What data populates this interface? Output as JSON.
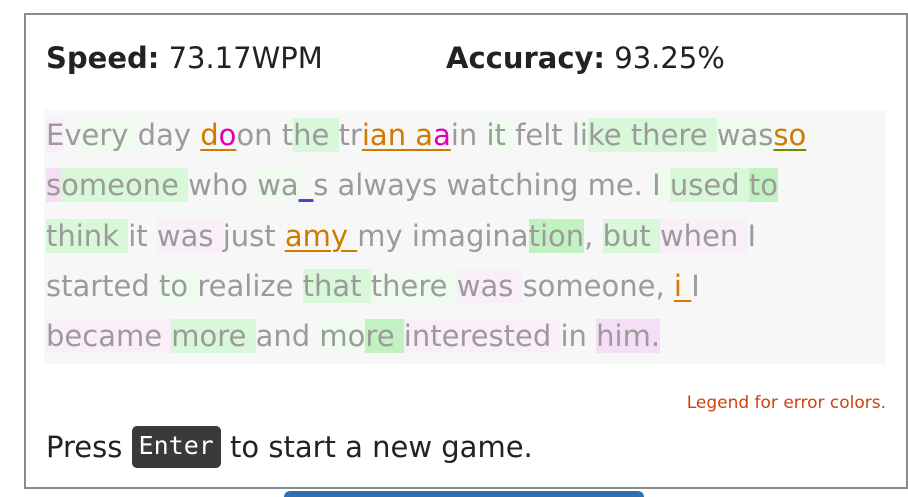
{
  "stats": {
    "speed_label": "Speed:",
    "speed_value": "73.17WPM",
    "accuracy_label": "Accuracy:",
    "accuracy_value": "93.25%"
  },
  "passage": {
    "lines": [
      [
        {
          "t": "E",
          "s": "p1"
        },
        {
          "t": "v",
          "s": ""
        },
        {
          "t": "ery ",
          "s": "g1"
        },
        {
          "t": "day ",
          "s": ""
        },
        {
          "t": "d",
          "s": "err-o"
        },
        {
          "t": "o",
          "s": "err-m"
        },
        {
          "t": "on ",
          "s": ""
        },
        {
          "t": "t",
          "s": "g1"
        },
        {
          "t": "he ",
          "s": "g2"
        },
        {
          "t": "tr",
          "s": ""
        },
        {
          "t": "ian a",
          "s": "err-o"
        },
        {
          "t": "a",
          "s": "err-m"
        },
        {
          "t": "in ",
          "s": ""
        },
        {
          "t": "it ",
          "s": "g1"
        },
        {
          "t": "felt ",
          "s": ""
        },
        {
          "t": "li",
          "s": "g1"
        },
        {
          "t": "ke ",
          "s": "g2"
        },
        {
          "t": "there ",
          "s": "g2"
        },
        {
          "t": "was",
          "s": "g1"
        },
        {
          "t": "so",
          "s": "err-y"
        }
      ],
      [
        {
          "t": "s",
          "s": "p2"
        },
        {
          "t": "omeone ",
          "s": "g2"
        },
        {
          "t": "who ",
          "s": ""
        },
        {
          "t": "wa",
          "s": "g1"
        },
        {
          "t": "_",
          "s": "err-b"
        },
        {
          "t": "s ",
          "s": ""
        },
        {
          "t": "always ",
          "s": ""
        },
        {
          "t": "watching ",
          "s": ""
        },
        {
          "t": "me. ",
          "s": ""
        },
        {
          "t": "I ",
          "s": "g1"
        },
        {
          "t": "used ",
          "s": "g2"
        },
        {
          "t": "to",
          "s": "g3"
        }
      ],
      [
        {
          "t": "think ",
          "s": "g2"
        },
        {
          "t": "it ",
          "s": ""
        },
        {
          "t": "was ",
          "s": "p1"
        },
        {
          "t": "just ",
          "s": ""
        },
        {
          "t": "amy ",
          "s": "err-o"
        },
        {
          "t": "my ",
          "s": ""
        },
        {
          "t": "imagina",
          "s": ""
        },
        {
          "t": "tion",
          "s": "g3"
        },
        {
          "t": ", ",
          "s": ""
        },
        {
          "t": "but ",
          "s": "g2"
        },
        {
          "t": "when ",
          "s": "p1"
        },
        {
          "t": "I",
          "s": ""
        }
      ],
      [
        {
          "t": "started ",
          "s": ""
        },
        {
          "t": "to ",
          "s": "g1"
        },
        {
          "t": "realize ",
          "s": ""
        },
        {
          "t": "that ",
          "s": "g2"
        },
        {
          "t": "there ",
          "s": "g1"
        },
        {
          "t": "was ",
          "s": "p1"
        },
        {
          "t": "someone, ",
          "s": ""
        },
        {
          "t": "i ",
          "s": "err-o"
        },
        {
          "t": "I",
          "s": ""
        }
      ],
      [
        {
          "t": "became ",
          "s": "p1"
        },
        {
          "t": "more ",
          "s": "g2"
        },
        {
          "t": "and ",
          "s": ""
        },
        {
          "t": "mo",
          "s": "g1"
        },
        {
          "t": "re ",
          "s": "g3"
        },
        {
          "t": "interested ",
          "s": "p1"
        },
        {
          "t": "in ",
          "s": ""
        },
        {
          "t": "him.",
          "s": "p2"
        }
      ]
    ]
  },
  "legend_link": "Legend for error colors.",
  "prompt": {
    "before": "Press",
    "key": "Enter",
    "after": "to start a new game."
  },
  "colors": {
    "correct_text": "#9b9b9b",
    "error_orange": "#d07a00",
    "error_magenta": "#e000b0",
    "error_blue": "#5b3bd8",
    "legend_link": "#d04010",
    "key_background": "#3a3a3a"
  }
}
